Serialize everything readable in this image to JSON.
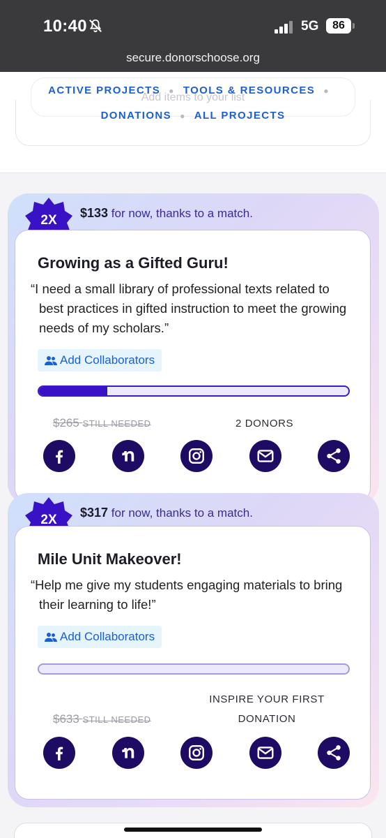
{
  "status_bar": {
    "time": "10:40",
    "network": "5G",
    "battery": "86"
  },
  "browser": {
    "url": "secure.donorschoose.org"
  },
  "nav": {
    "placeholder_text": "Add items to your list",
    "row1": [
      "ACTIVE PROJECTS",
      "TOOLS & RESOURCES"
    ],
    "row2": [
      "DONATIONS",
      "ALL PROJECTS"
    ]
  },
  "projects": [
    {
      "badge": "2X",
      "match_amount": "$133",
      "match_text": "for now, thanks to a match.",
      "title": "Growing as a Gifted Guru!",
      "quote": "“I need a small library of professional texts related to best practices in gifted instruction to meet the growing needs of my scholars.”",
      "collab_label": "Add Collaborators",
      "progress_fraction": 0.22,
      "needed_amount": "$265",
      "needed_label": "STILL NEEDED",
      "donors": "2 DONORS"
    },
    {
      "badge": "2X",
      "match_amount": "$317",
      "match_text": "for now, thanks to a match.",
      "title": "Mile Unit Makeover!",
      "quote": "“Help me give my students engaging materials to bring their learning to life!”",
      "collab_label": "Add Collaborators",
      "progress_fraction": 0,
      "needed_amount": "$633",
      "needed_label": "STILL NEEDED",
      "donors": "INSPIRE YOUR FIRST DONATION"
    }
  ],
  "share_icons": [
    "facebook-icon",
    "nextdoor-icon",
    "instagram-icon",
    "email-icon",
    "share-icon"
  ],
  "colors": {
    "brand_blue": "#1c5fd1",
    "deep_purple": "#1e0b63",
    "progress": "#3a12c6",
    "badge": "#3a12c6"
  }
}
